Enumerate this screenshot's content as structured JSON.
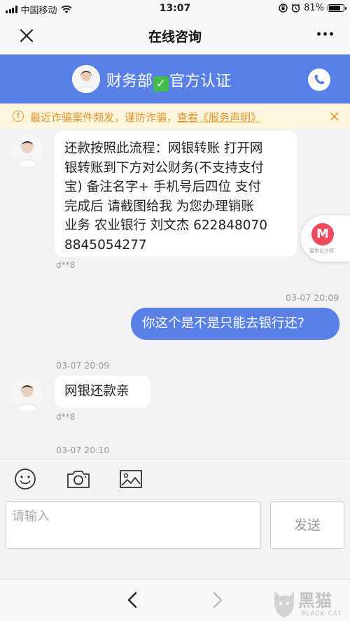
{
  "status_bar": {
    "carrier": "中国移动",
    "time": "13:07",
    "battery": "81%",
    "battery_level": 0.81,
    "icons": [
      "signal-icon",
      "wifi-icon",
      "orientation-lock-icon",
      "alarm-icon",
      "battery-icon"
    ]
  },
  "nav": {
    "title": "在线咨询",
    "close_icon": "close-icon",
    "more_icon": "more-icon"
  },
  "header": {
    "name_part1": "财务部",
    "name_part2": "官方认证",
    "check_glyph": "✓",
    "call_icon": "phone-icon",
    "color": "#5880e6"
  },
  "notice": {
    "text": "最近诈骗案件频发，谨防诈骗，",
    "link": "查看《服务声明》",
    "close": "×",
    "icon_glyph": "!"
  },
  "messages": {
    "m1": {
      "lines": [
        "还款按照此流程：网银转账 打开网",
        "银转账到下方对公财务(不支持支付",
        "宝) 备注名字+ 手机号后四位 支付",
        "完成后 请截图给我 为您办理销账",
        "业务 农业银行  刘文杰  622848070",
        "8845054277"
      ],
      "sender": "d**8"
    },
    "m2": {
      "time": "03-07 20:09",
      "text": "你这个是不是只能去银行还?"
    },
    "m3": {
      "time": "03-07 20:09",
      "text": "网银还款亲",
      "sender": "d**8"
    },
    "m4": {
      "time": "03-07 20:10"
    }
  },
  "float_badge": {
    "letter": "M",
    "caption": "留学设计师"
  },
  "input": {
    "placeholder": "请输入",
    "send_label": "发送",
    "tools": [
      "emoji-icon",
      "camera-icon",
      "image-icon"
    ]
  },
  "bottom": {
    "back": "‹",
    "forward": "›"
  },
  "watermark": {
    "text": "黑猫",
    "sub": "BLACK CAT"
  }
}
